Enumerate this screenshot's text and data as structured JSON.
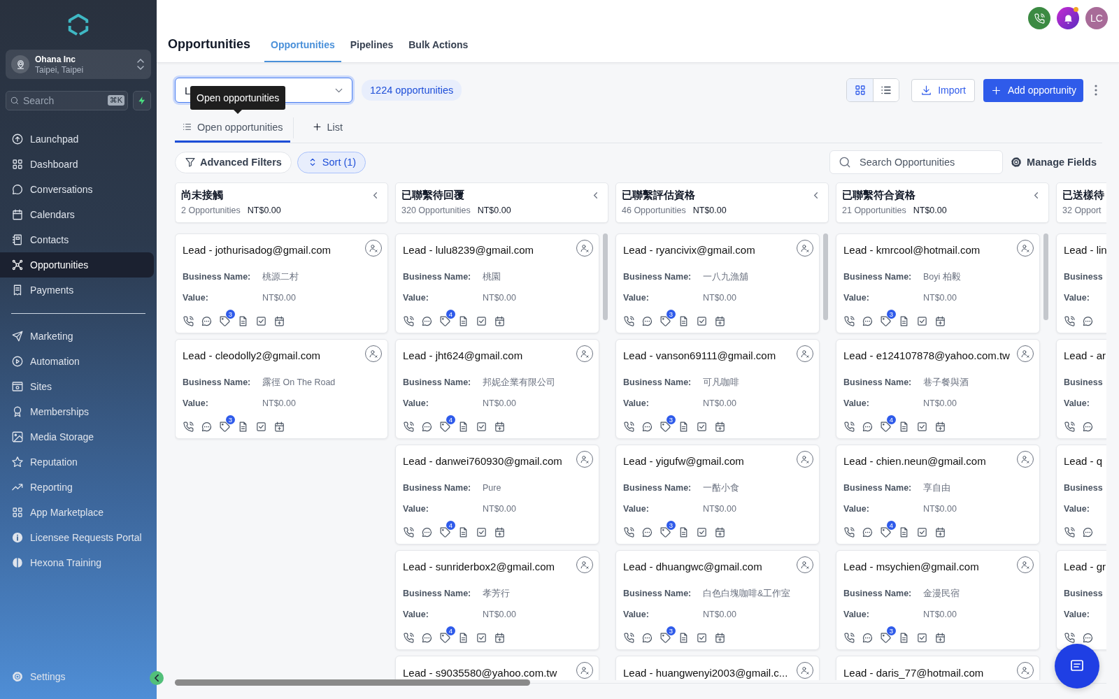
{
  "sidebar": {
    "account": {
      "name": "Ohana Inc",
      "location": "Taipei, Taipei"
    },
    "search": {
      "placeholder": "Search",
      "shortcut": "⌘K"
    },
    "nav": [
      {
        "label": "Launchpad",
        "selected": false
      },
      {
        "label": "Dashboard",
        "selected": false
      },
      {
        "label": "Conversations",
        "selected": false
      },
      {
        "label": "Calendars",
        "selected": false
      },
      {
        "label": "Contacts",
        "selected": false
      },
      {
        "label": "Opportunities",
        "selected": true
      },
      {
        "label": "Payments",
        "selected": false
      }
    ],
    "nav_secondary": [
      {
        "label": "Marketing",
        "selected": false
      },
      {
        "label": "Automation",
        "selected": false
      },
      {
        "label": "Sites",
        "selected": false
      },
      {
        "label": "Memberships",
        "selected": false
      },
      {
        "label": "Media Storage",
        "selected": false
      },
      {
        "label": "Reputation",
        "selected": false
      },
      {
        "label": "Reporting",
        "selected": false
      },
      {
        "label": "App Marketplace",
        "selected": false
      },
      {
        "label": "Licensee Requests Portal",
        "selected": false
      },
      {
        "label": "Hexona Training",
        "selected": false
      }
    ],
    "settings": "Settings"
  },
  "header": {
    "title": "Opportunities",
    "tabs": [
      {
        "label": "Opportunities",
        "selected": true
      },
      {
        "label": "Pipelines",
        "selected": false
      },
      {
        "label": "Bulk Actions",
        "selected": false
      }
    ],
    "notifications_unread": true,
    "avatar": "LC"
  },
  "toolbar": {
    "pipeline_select": {
      "value": "L"
    },
    "tooltip": "Open opportunities",
    "count": "1224 opportunities",
    "view_toggle": [
      {
        "kind": "grid",
        "selected": true
      },
      {
        "kind": "list",
        "selected": false
      }
    ],
    "import": "Import",
    "add": "Add opportunity"
  },
  "view_tabs": [
    {
      "kind": "view",
      "label": "Open opportunities",
      "selected": true
    },
    {
      "kind": "add",
      "label": "List",
      "selected": false
    }
  ],
  "filters": {
    "advanced": "Advanced Filters",
    "sort": {
      "label": "Sort (1)",
      "active": true
    },
    "search_placeholder": "Search Opportunities",
    "manage": "Manage Fields"
  },
  "columns": [
    {
      "kind": "full",
      "title": "尚未接觸",
      "count": "2 Opportunities",
      "total": "NT$0.00",
      "cards": [
        {
          "kind": "full",
          "title": "Lead - jothurisadog@gmail.com",
          "business_label": "Business Name:",
          "business": "桃源二村",
          "value_label": "Value:",
          "value": "NT$0.00",
          "badge": "3"
        },
        {
          "kind": "full",
          "title": "Lead - cleodolly2@gmail.com",
          "business_label": "Business Name:",
          "business": "露徑 On The Road",
          "value_label": "Value:",
          "value": "NT$0.00",
          "badge": "3"
        }
      ]
    },
    {
      "kind": "full",
      "title": "已聯繫待回覆",
      "count": "320 Opportunities",
      "total": "NT$0.00",
      "cards": [
        {
          "kind": "full",
          "title": "Lead - lulu8239@gmail.com",
          "business_label": "Business Name:",
          "business": "桃園",
          "value_label": "Value:",
          "value": "NT$0.00",
          "badge": "4"
        },
        {
          "kind": "full",
          "title": "Lead - jht624@gmail.com",
          "business_label": "Business Name:",
          "business": "邦妮企業有限公司",
          "value_label": "Value:",
          "value": "NT$0.00",
          "badge": "4"
        },
        {
          "kind": "full",
          "title": "Lead - danwei760930@gmail.com",
          "business_label": "Business Name:",
          "business": "Pure",
          "value_label": "Value:",
          "value": "NT$0.00",
          "badge": "4"
        },
        {
          "kind": "full",
          "title": "Lead - sunriderbox2@gmail.com",
          "business_label": "Business Name:",
          "business": "孝芳行",
          "value_label": "Value:",
          "value": "NT$0.00",
          "badge": "4"
        },
        {
          "kind": "cut-bottom",
          "title": "Lead - s9035580@yahoo.com.tw"
        }
      ]
    },
    {
      "kind": "full",
      "title": "已聯繫評估資格",
      "count": "46 Opportunities",
      "total": "NT$0.00",
      "cards": [
        {
          "kind": "full",
          "title": "Lead - ryancivix@gmail.com",
          "business_label": "Business Name:",
          "business": "一八九漁舖",
          "value_label": "Value:",
          "value": "NT$0.00",
          "badge": "3"
        },
        {
          "kind": "full",
          "title": "Lead - vanson69111@gmail.com",
          "business_label": "Business Name:",
          "business": "可凡咖啡",
          "value_label": "Value:",
          "value": "NT$0.00",
          "badge": "3"
        },
        {
          "kind": "full",
          "title": "Lead - yigufw@gmail.com",
          "business_label": "Business Name:",
          "business": "一酤小食",
          "value_label": "Value:",
          "value": "NT$0.00",
          "badge": "3"
        },
        {
          "kind": "full",
          "title": "Lead - dhuangwc@gmail.com",
          "business_label": "Business Name:",
          "business": "白色白塊咖啡&工作室",
          "value_label": "Value:",
          "value": "NT$0.00",
          "badge": "3"
        },
        {
          "kind": "cut-bottom",
          "title": "Lead - huangwenyi2003@gmail.c..."
        }
      ]
    },
    {
      "kind": "full",
      "title": "已聯繫符合資格",
      "count": "21 Opportunities",
      "total": "NT$0.00",
      "cards": [
        {
          "kind": "full",
          "title": "Lead - kmrcool@hotmail.com",
          "business_label": "Business Name:",
          "business": "Boyi 柏毅",
          "value_label": "Value:",
          "value": "NT$0.00",
          "badge": "3"
        },
        {
          "kind": "full",
          "title": "Lead - e124107878@yahoo.com.tw",
          "business_label": "Business Name:",
          "business": "巷子餐與酒",
          "value_label": "Value:",
          "value": "NT$0.00",
          "badge": "4"
        },
        {
          "kind": "full",
          "title": "Lead - chien.neun@gmail.com",
          "business_label": "Business Name:",
          "business": "享自由",
          "value_label": "Value:",
          "value": "NT$0.00",
          "badge": "4"
        },
        {
          "kind": "full",
          "title": "Lead - msychien@gmail.com",
          "business_label": "Business Name:",
          "business": "金漫民宿",
          "value_label": "Value:",
          "value": "NT$0.00",
          "badge": "3"
        },
        {
          "kind": "cut-bottom",
          "title": "Lead - daris_77@hotmail.com"
        }
      ]
    },
    {
      "kind": "cut-right",
      "title": "已送樣待",
      "count": "32 Opport",
      "cards": [
        {
          "kind": "cut-right",
          "title": "Lead - lin",
          "business_label": "Business",
          "value_label": "Value:"
        },
        {
          "kind": "cut-right",
          "title": "Lead - ar",
          "business_label": "Business",
          "value_label": "Value:"
        },
        {
          "kind": "cut-right",
          "title": "Lead - q",
          "business_label": "Business",
          "value_label": "Value:"
        },
        {
          "kind": "cut-right",
          "title": "Lead - gr",
          "business_label": "Business",
          "value_label": "Value:"
        }
      ]
    }
  ]
}
